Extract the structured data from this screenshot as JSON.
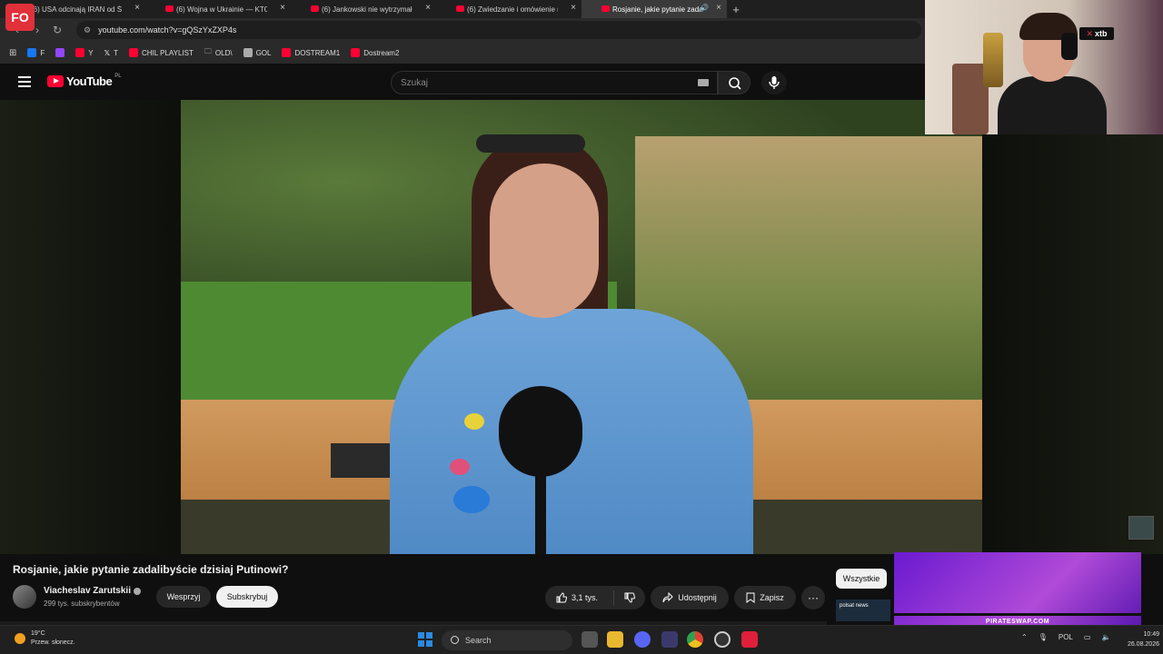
{
  "browser": {
    "tabs": [
      {
        "title": "(6) USA odcinają IRAN od ŚWIA",
        "active": false
      },
      {
        "title": "(6) Wojna w Ukrainie — KTO N",
        "active": false
      },
      {
        "title": "(6) Jankowski nie wytrzymał. \"Z",
        "active": false
      },
      {
        "title": "(6) Zwiedzanie i omówienie na",
        "active": false
      },
      {
        "title": "Rosjanie, jakie pytanie zada",
        "active": true
      }
    ],
    "new_tab_label": "+",
    "url": "youtube.com/watch?v=gQSzYxZXP4s",
    "bookmarks": [
      {
        "label": "F",
        "color": "#1877f2"
      },
      {
        "label": "",
        "color": "#9146ff"
      },
      {
        "label": "Y",
        "color": "#ff0033"
      },
      {
        "label": "T",
        "color": "#444444"
      },
      {
        "label": "CHIL PLAYLIST",
        "color": "#ff0033"
      },
      {
        "label": "OLD\\",
        "color": "#888888"
      },
      {
        "label": "GOL",
        "color": "#aaaaaa"
      },
      {
        "label": "DOSTREAM1",
        "color": "#ff0033"
      },
      {
        "label": "Dostream2",
        "color": "#ff0033"
      }
    ]
  },
  "streamer_logo": "FO",
  "youtube": {
    "logo_word": "YouTube",
    "logo_country": "PL",
    "search_placeholder": "Szukaj",
    "video_title": "Rosjanie, jakie pytanie zadalibyście dzisiaj Putinowi?",
    "channel_name": "Viacheslav Zarutskii",
    "subscribers": "299 tys. subskrybentów",
    "support_label": "Wesprzyj",
    "subscribe_label": "Subskrybuj",
    "likes": "3,1 tys.",
    "share_label": "Udostępnij",
    "save_label": "Zapisz",
    "more_label": "···",
    "chip_all": "Wszystkie",
    "ad_text": "PIRATESWAP.COM",
    "polsat_text": "polsat news"
  },
  "webcam": {
    "badge": "xtb"
  },
  "taskbar": {
    "temperature": "19°C",
    "weather": "Przew. słonecz.",
    "search_label": "Search",
    "language": "POL",
    "time": "10:49",
    "date": "26.08.2026"
  },
  "colors": {
    "yt_red": "#ff0033",
    "bg": "#0f0f0f",
    "button": "#272727",
    "win_blue": "#2a8ae0"
  }
}
